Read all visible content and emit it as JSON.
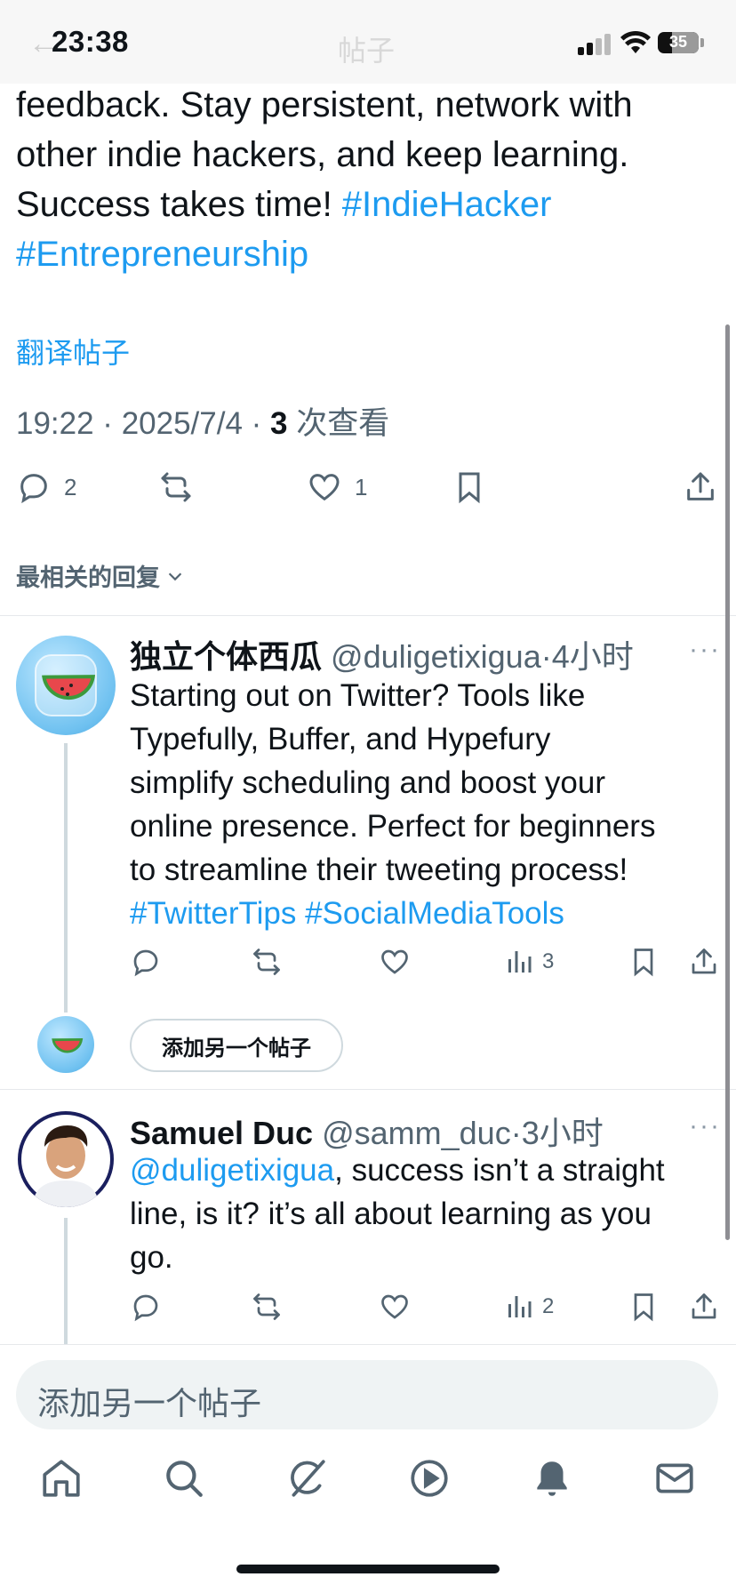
{
  "status": {
    "time": "23:38",
    "battery": "35",
    "back_ghost": "←",
    "title_ghost": "帖子"
  },
  "post": {
    "text_line1": "feedback. Stay persistent, network with",
    "text_line2": "other indie hackers, and keep learning.",
    "text_line3": "Success takes time! ",
    "hashtag1": "#IndieHacker",
    "hashtag2": "#Entrepreneurship",
    "translate": "翻译帖子",
    "timestamp": "19:22 · 2025/7/4 · ",
    "views_count": "3",
    "views_label": " 次查看",
    "actions": {
      "replies": "2",
      "likes": "1"
    }
  },
  "sort_label": "最相关的回复",
  "replies": [
    {
      "name": "独立个体西瓜",
      "handle": "@duligetixigua",
      "time": "·4小时",
      "body_line1": "Starting out on Twitter? Tools like",
      "body_line2": "Typefully, Buffer, and Hypefury",
      "body_line3": "simplify scheduling and boost your",
      "body_line4": "online presence. Perfect for beginners",
      "body_line5": "to streamline their tweeting process!",
      "hashtags": "#TwitterTips #SocialMediaTools",
      "views": "3"
    },
    {
      "name": "Samuel Duc",
      "handle": "@samm_duc",
      "time": "·3小时",
      "mention": "@duligetixigua",
      "body_line1_rest": ", success isn’t a straight",
      "body_line2": "line, is it? it’s all about learning as you",
      "body_line3": "go.",
      "views": "2"
    }
  ],
  "add_another_pill": "添加另一个帖子",
  "more": "···",
  "compose_placeholder": "添加另一个帖子",
  "colors": {
    "accent": "#1d9bf0",
    "text": "#0f1419",
    "secondary": "#536471"
  },
  "tabs": [
    "home-icon",
    "search-icon",
    "grok-icon",
    "video-icon",
    "notifications-icon",
    "messages-icon"
  ]
}
